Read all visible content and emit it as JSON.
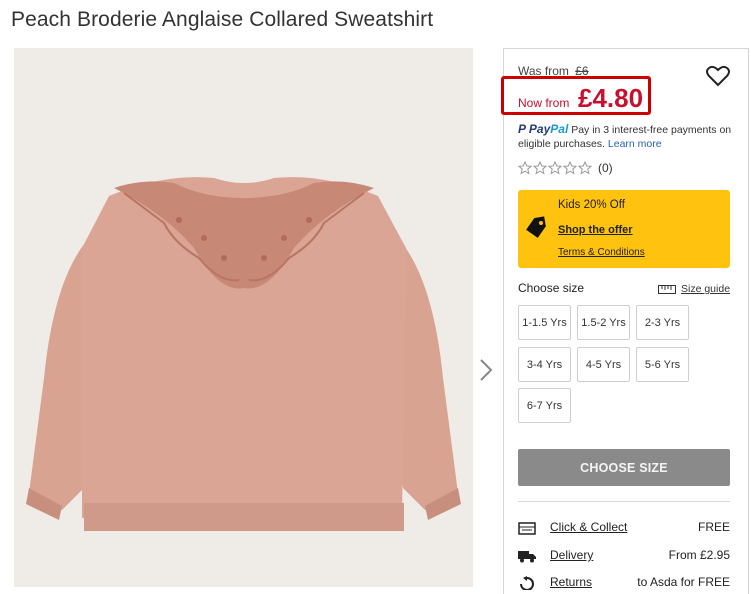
{
  "product": {
    "title": "Peach Broderie Anglaise Collared Sweatshirt"
  },
  "price": {
    "was_label": "Was from",
    "was_value": "£6",
    "now_label": "Now from",
    "now_value": "£4.80",
    "accent_color": "#c8102e"
  },
  "paypal": {
    "brand_pay": "Pay",
    "brand_pal": "Pal",
    "text": "Pay in 3 interest-free payments on eligible purchases.",
    "learn_more": "Learn more"
  },
  "rating": {
    "count": "(0)",
    "stars": 0,
    "max": 5
  },
  "offer": {
    "title": "Kids 20% Off",
    "link": "Shop the offer",
    "terms": "Terms & Conditions",
    "color": "#ffc20e"
  },
  "sizes": {
    "heading": "Choose size",
    "guide": "Size guide",
    "options": [
      "1-1.5 Yrs",
      "1.5-2 Yrs",
      "2-3 Yrs",
      "3-4 Yrs",
      "4-5 Yrs",
      "5-6 Yrs",
      "6-7 Yrs"
    ]
  },
  "actions": {
    "choose_size": "CHOOSE SIZE"
  },
  "delivery": [
    {
      "icon": "store-icon",
      "label": "Click & Collect",
      "value": "FREE"
    },
    {
      "icon": "truck-icon",
      "label": "Delivery",
      "value": "From £2.95"
    },
    {
      "icon": "returns-icon",
      "label": "Returns",
      "value": "to Asda for FREE"
    }
  ]
}
